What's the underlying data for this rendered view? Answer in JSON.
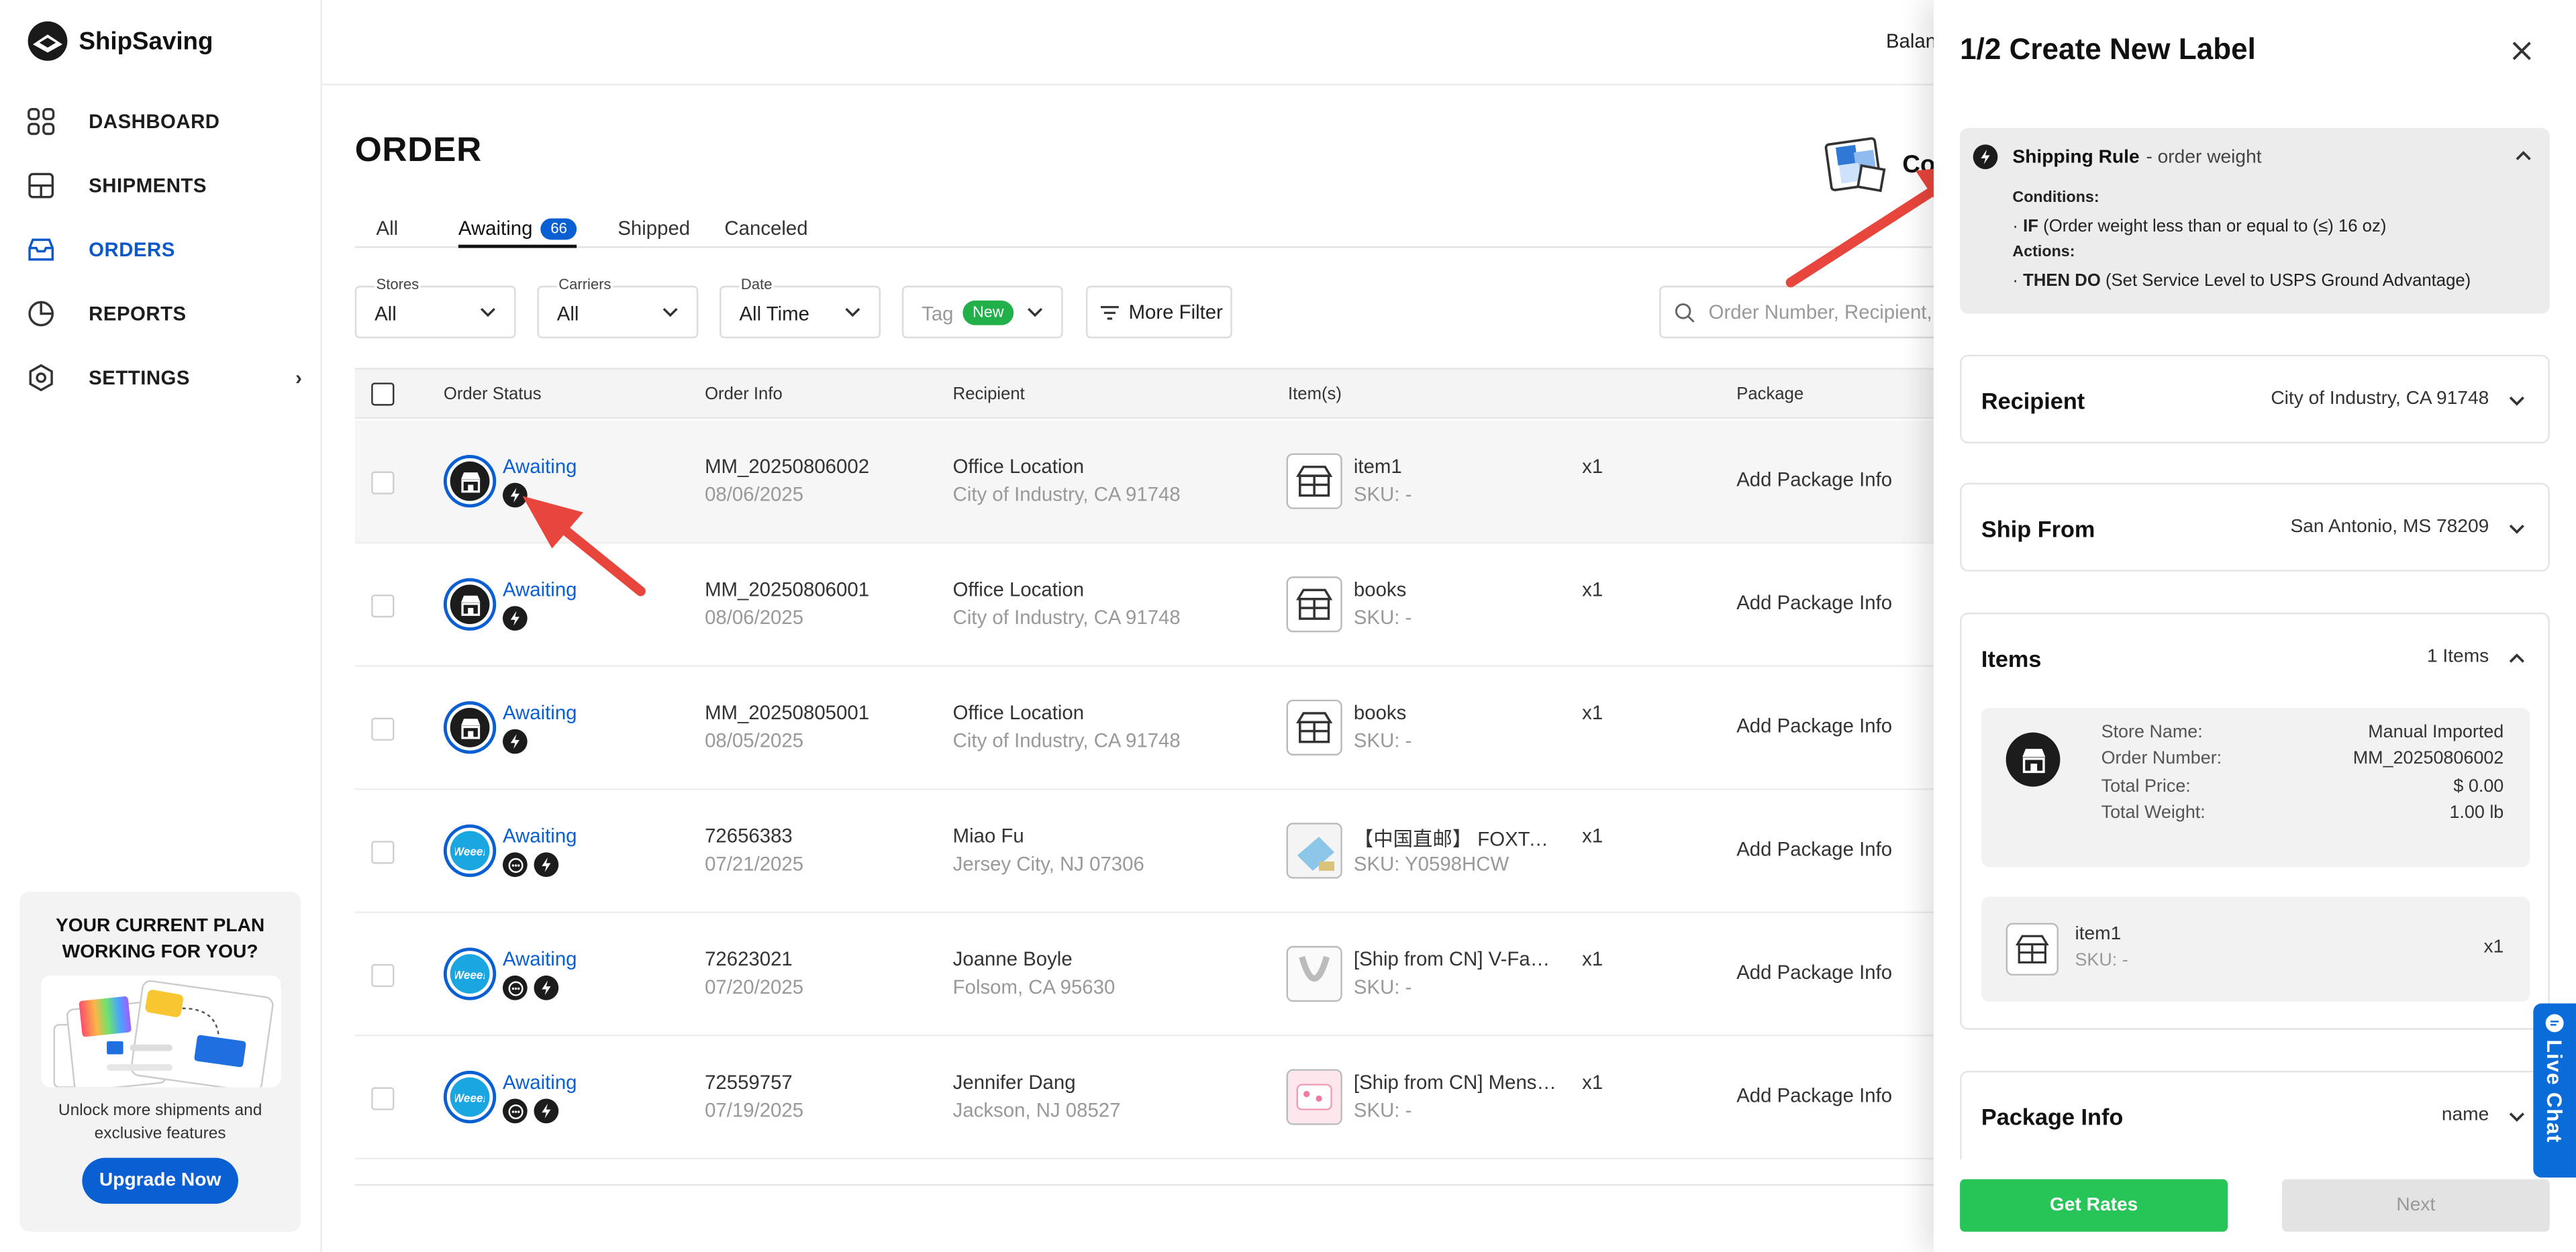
{
  "app": {
    "name": "ShipSaving"
  },
  "sidebar": {
    "items": [
      {
        "label": "DASHBOARD",
        "icon": "dashboard-grid-icon"
      },
      {
        "label": "SHIPMENTS",
        "icon": "shipments-icon"
      },
      {
        "label": "ORDERS",
        "icon": "orders-inbox-icon",
        "active": true
      },
      {
        "label": "REPORTS",
        "icon": "reports-pie-icon"
      },
      {
        "label": "SETTINGS",
        "icon": "settings-gear-icon",
        "chevron": "›"
      }
    ],
    "promo": {
      "title_line1": "YOUR CURRENT PLAN",
      "title_line2": "WORKING FOR YOU?",
      "text_line1": "Unlock more shipments and",
      "text_line2": "exclusive features",
      "button": "Upgrade Now"
    }
  },
  "header": {
    "balance_label": "Balan",
    "co_text": "Co"
  },
  "page": {
    "title": "ORDER"
  },
  "tabs": [
    {
      "label": "All"
    },
    {
      "label": "Awaiting",
      "badge": "66",
      "active": true
    },
    {
      "label": "Shipped"
    },
    {
      "label": "Canceled"
    }
  ],
  "filters": {
    "stores": {
      "label": "Stores",
      "value": "All"
    },
    "carriers": {
      "label": "Carriers",
      "value": "All"
    },
    "date": {
      "label": "Date",
      "value": "All Time"
    },
    "tag": {
      "label": "Tag",
      "badge": "New"
    },
    "more": "More Filter",
    "search_placeholder": "Order Number, Recipient, Tr"
  },
  "table": {
    "headers": {
      "status": "Order Status",
      "info": "Order Info",
      "recipient": "Recipient",
      "items": "Item(s)",
      "package": "Package"
    },
    "rows": [
      {
        "status": "Awaiting",
        "store": "manual",
        "chat": false,
        "order": "MM_20250806002",
        "date": "08/06/2025",
        "name": "Office Location",
        "addr": "City of Industry, CA 91748",
        "item": "item1",
        "sku": "SKU: -",
        "qty": "x1",
        "pkg": "Add Package Info",
        "thumb": "box"
      },
      {
        "status": "Awaiting",
        "store": "manual",
        "chat": false,
        "order": "MM_20250806001",
        "date": "08/06/2025",
        "name": "Office Location",
        "addr": "City of Industry, CA 91748",
        "item": "books",
        "sku": "SKU: -",
        "qty": "x1",
        "pkg": "Add Package Info",
        "thumb": "box"
      },
      {
        "status": "Awaiting",
        "store": "manual",
        "chat": false,
        "order": "MM_20250805001",
        "date": "08/05/2025",
        "name": "Office Location",
        "addr": "City of Industry, CA 91748",
        "item": "books",
        "sku": "SKU: -",
        "qty": "x1",
        "pkg": "Add Package Info",
        "thumb": "box"
      },
      {
        "status": "Awaiting",
        "store": "weee",
        "chat": true,
        "order": "72656383",
        "date": "07/21/2025",
        "name": "Miao Fu",
        "addr": "Jersey City, NJ 07306",
        "item": "【中国直邮】 FOXTAI...",
        "sku": "SKU: Y0598HCW",
        "qty": "x1",
        "pkg": "Add Package Info",
        "thumb": "photo-blue"
      },
      {
        "status": "Awaiting",
        "store": "weee",
        "chat": true,
        "order": "72623021",
        "date": "07/20/2025",
        "name": "Joanne Boyle",
        "addr": "Folsom, CA 95630",
        "item": "[Ship from CN] V-Face ...",
        "sku": "SKU: -",
        "qty": "x1",
        "pkg": "Add Package Info",
        "thumb": "photo-v"
      },
      {
        "status": "Awaiting",
        "store": "weee",
        "chat": true,
        "order": "72559757",
        "date": "07/19/2025",
        "name": "Jennifer Dang",
        "addr": "Jackson, NJ 08527",
        "item": "[Ship from CN] Menstr...",
        "sku": "SKU: -",
        "qty": "x1",
        "pkg": "Add Package Info",
        "thumb": "photo-pink"
      }
    ]
  },
  "panel": {
    "title": "1/2 Create New Label",
    "rule": {
      "name": "Shipping Rule",
      "sub": "- order weight",
      "conditions_label": "Conditions:",
      "cond_prefix": "· ",
      "cond_kw": "IF",
      "cond_text": " (Order weight less than or equal to (≤) 16 oz)",
      "actions_label": "Actions:",
      "act_prefix": "· ",
      "act_kw": "THEN DO",
      "act_text": " (Set Service Level to USPS Ground Advantage)"
    },
    "recipient": {
      "title": "Recipient",
      "value": "City of Industry, CA 91748"
    },
    "ship_from": {
      "title": "Ship From",
      "value": "San Antonio, MS 78209"
    },
    "items": {
      "title": "Items",
      "count": "1 Items",
      "store_name_label": "Store Name:",
      "store_name": "Manual Imported",
      "order_number_label": "Order Number:",
      "order_number": "MM_20250806002",
      "total_price_label": "Total Price:",
      "total_price": "$ 0.00",
      "total_weight_label": "Total Weight:",
      "total_weight": "1.00 lb",
      "item_name": "item1",
      "item_sku": "SKU: -",
      "item_qty": "x1"
    },
    "package": {
      "title": "Package Info",
      "value": "name"
    },
    "get_rates": "Get Rates",
    "next": "Next"
  },
  "live_chat": "Live Chat",
  "colors": {
    "brand_blue": "#0a5fd3",
    "green": "#27c457",
    "arrow_red": "#e8453c"
  }
}
